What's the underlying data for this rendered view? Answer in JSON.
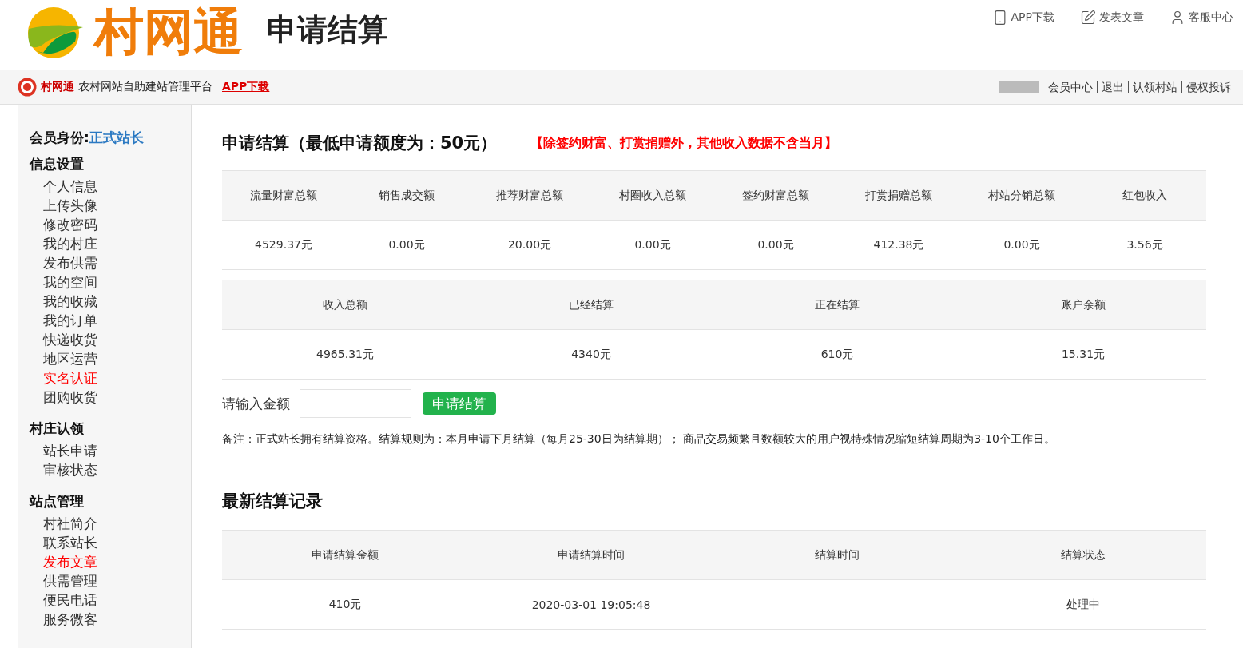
{
  "header": {
    "logo_text": "村网通",
    "page_title": "申请结算",
    "links": [
      {
        "kind": "phone",
        "label": "APP下载"
      },
      {
        "kind": "edit",
        "label": "发表文章"
      },
      {
        "kind": "user",
        "label": "客服中心"
      }
    ]
  },
  "topbar": {
    "brand": "村网通",
    "tagline": "农村网站自助建站管理平台",
    "app_link": "APP下载",
    "links": [
      "会员中心",
      "退出",
      "认领村站",
      "侵权投诉"
    ]
  },
  "sidebar": {
    "identity_label": "会员身份:",
    "identity_value": "正式站长",
    "sections": [
      {
        "title": "信息设置",
        "items": [
          {
            "label": "个人信息",
            "highlighted": false
          },
          {
            "label": "上传头像",
            "highlighted": false
          },
          {
            "label": "修改密码",
            "highlighted": false
          },
          {
            "label": "我的村庄",
            "highlighted": false
          },
          {
            "label": "发布供需",
            "highlighted": false
          },
          {
            "label": "我的空间",
            "highlighted": false
          },
          {
            "label": "我的收藏",
            "highlighted": false
          },
          {
            "label": "我的订单",
            "highlighted": false
          },
          {
            "label": "快递收货",
            "highlighted": false
          },
          {
            "label": "地区运营",
            "highlighted": false
          },
          {
            "label": "实名认证",
            "highlighted": true
          },
          {
            "label": "团购收货",
            "highlighted": false
          }
        ]
      },
      {
        "title": "村庄认领",
        "items": [
          {
            "label": "站长申请",
            "highlighted": false
          },
          {
            "label": "审核状态",
            "highlighted": false
          }
        ]
      },
      {
        "title": "站点管理",
        "items": [
          {
            "label": "村社简介",
            "highlighted": false
          },
          {
            "label": "联系站长",
            "highlighted": false
          },
          {
            "label": "发布文章",
            "highlighted": true
          },
          {
            "label": "供需管理",
            "highlighted": false
          },
          {
            "label": "便民电话",
            "highlighted": false
          },
          {
            "label": "服务微客",
            "highlighted": false
          }
        ]
      }
    ]
  },
  "main": {
    "title": "申请结算（最低申请额度为：50元）",
    "notice": "【除签约财富、打赏捐赠外，其他收入数据不含当月】",
    "income_table": {
      "columns": [
        "流量财富总额",
        "销售成交额",
        "推荐财富总额",
        "村圈收入总额",
        "签约财富总额",
        "打赏捐赠总额",
        "村站分销总额",
        "红包收入"
      ],
      "values": [
        "4529.37元",
        "0.00元",
        "20.00元",
        "0.00元",
        "0.00元",
        "412.38元",
        "0.00元",
        "3.56元"
      ]
    },
    "summary_table": {
      "columns": [
        "收入总额",
        "已经结算",
        "正在结算",
        "账户余额"
      ],
      "values": [
        "4965.31元",
        "4340元",
        "610元",
        "15.31元"
      ]
    },
    "amount_label": "请输入金额",
    "submit_button": "申请结算",
    "note": "备注：正式站长拥有结算资格。结算规则为：本月申请下月结算（每月25-30日为结算期）； 商品交易频繁且数额较大的用户视特殊情况缩短结算周期为3-10个工作日。",
    "records_title": "最新结算记录",
    "records_table": {
      "columns": [
        "申请结算金额",
        "申请结算时间",
        "结算时间",
        "结算状态"
      ],
      "rows": [
        [
          "410元",
          "2020-03-01 19:05:48",
          "",
          "处理中"
        ]
      ]
    }
  }
}
